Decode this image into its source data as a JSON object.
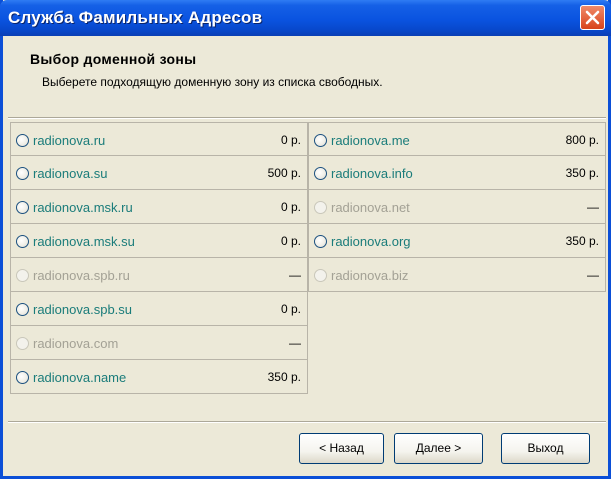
{
  "window": {
    "title": "Служба Фамильных Адресов"
  },
  "header": {
    "title": "Выбор доменной зоны",
    "subtitle": "Выберете подходящую доменную зону из списка свободных."
  },
  "left_column": [
    {
      "domain": "radionova.ru",
      "price": "0 р.",
      "enabled": true
    },
    {
      "domain": "radionova.su",
      "price": "500 р.",
      "enabled": true
    },
    {
      "domain": "radionova.msk.ru",
      "price": "0 р.",
      "enabled": true
    },
    {
      "domain": "radionova.msk.su",
      "price": "0 р.",
      "enabled": true
    },
    {
      "domain": "radionova.spb.ru",
      "price": "—",
      "enabled": false
    },
    {
      "domain": "radionova.spb.su",
      "price": "0 р.",
      "enabled": true
    },
    {
      "domain": "radionova.com",
      "price": "—",
      "enabled": false
    },
    {
      "domain": "radionova.name",
      "price": "350 р.",
      "enabled": true
    }
  ],
  "right_column": [
    {
      "domain": "radionova.me",
      "price": "800 р.",
      "enabled": true
    },
    {
      "domain": "radionova.info",
      "price": "350 р.",
      "enabled": true
    },
    {
      "domain": "radionova.net",
      "price": "—",
      "enabled": false
    },
    {
      "domain": "radionova.org",
      "price": "350 р.",
      "enabled": true
    },
    {
      "domain": "radionova.biz",
      "price": "—",
      "enabled": false
    }
  ],
  "buttons": {
    "back": "< Назад",
    "next": "Далее >",
    "exit": "Выход"
  }
}
